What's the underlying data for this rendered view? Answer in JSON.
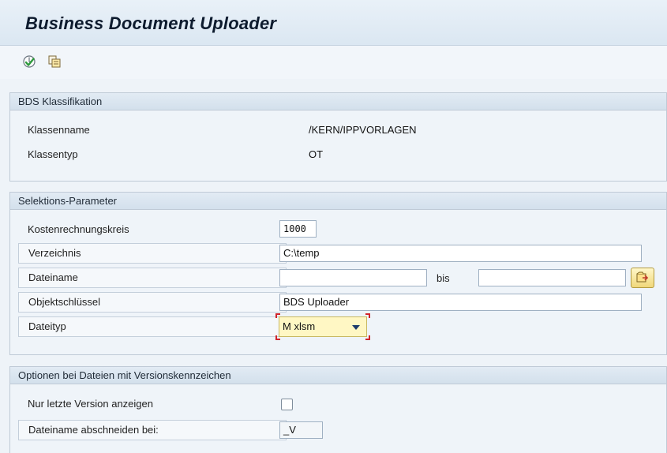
{
  "window": {
    "title": "Business Document Uploader"
  },
  "toolbar": {
    "buttons": [
      {
        "icon": "execute-icon"
      },
      {
        "icon": "copy-icon"
      }
    ]
  },
  "bds_classification": {
    "header": "BDS Klassifikation",
    "class_name_label": "Klassenname",
    "class_name_value": "/KERN/IPPVORLAGEN",
    "class_type_label": "Klassentyp",
    "class_type_value": "OT"
  },
  "selection": {
    "header": "Selektions-Parameter",
    "controlling_area_label": "Kostenrechnungskreis",
    "controlling_area_value": "1000",
    "directory_label": "Verzeichnis",
    "directory_value": "C:\\temp",
    "filename_label": "Dateiname",
    "filename_from_value": "",
    "filename_bis_label": "bis",
    "filename_to_value": "",
    "object_key_label": "Objektschlüssel",
    "object_key_value": "BDS Uploader",
    "filetype_label": "Dateityp",
    "filetype_value": "M xlsm"
  },
  "options": {
    "header": "Optionen bei Dateien mit Versionskennzeichen",
    "last_version_label": "Nur letzte Version anzeigen",
    "last_version_checked": false,
    "truncate_label": "Dateiname abschneiden bei:",
    "truncate_value": "_V"
  },
  "colors": {
    "accent_yellow": "#fff7c4",
    "focus_red": "#d0242b",
    "execute_green": "#2e9a3c"
  }
}
